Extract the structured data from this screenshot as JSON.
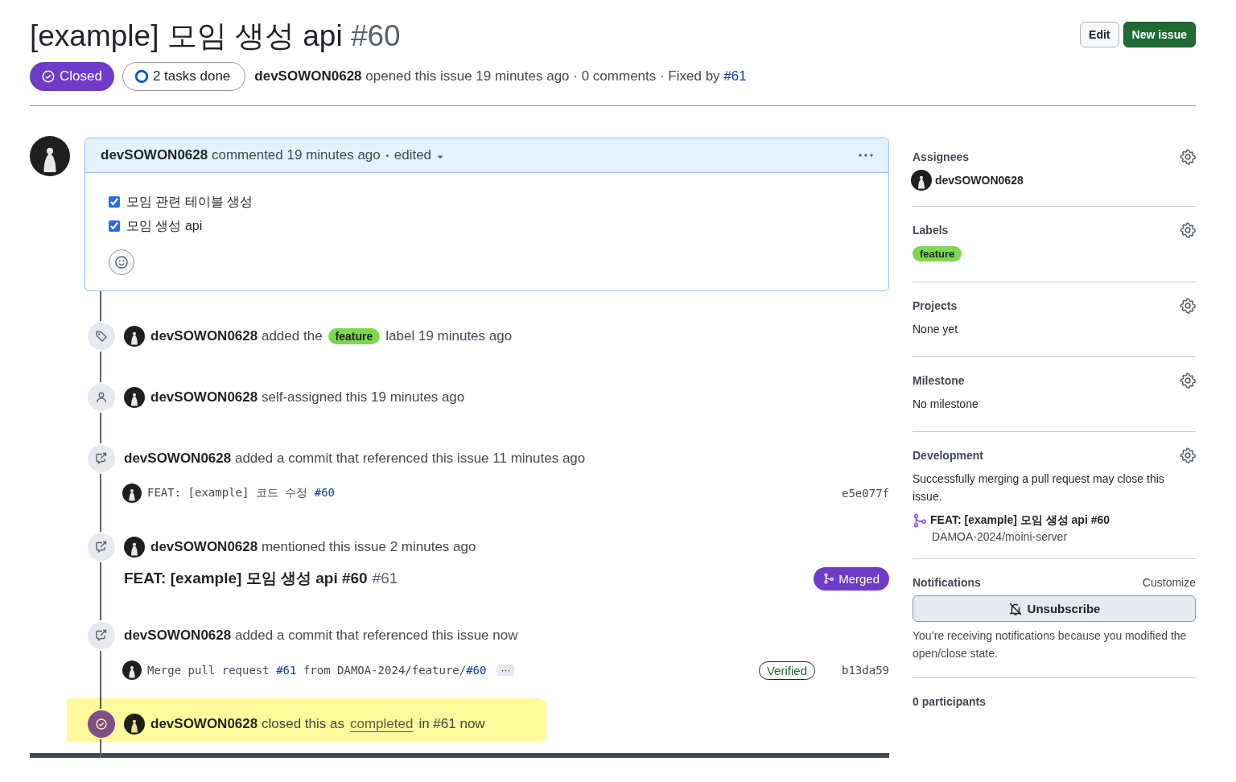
{
  "issue": {
    "title": "[example] 모임 생성 api",
    "number": "#60",
    "state": "Closed",
    "tasks": "2 tasks done",
    "meta": "**devSOWON0628** opened this issue 19 minutes ago · 0 comments · Fixed by",
    "fixed_by": "#61"
  },
  "header_buttons": [
    {
      "label": "Edit",
      "kind": "secondary"
    },
    {
      "label": "New issue",
      "kind": "primary"
    }
  ],
  "comment": {
    "header": "**devSOWON0628** commented 19 minutes ago",
    "edited": "edited",
    "tasks": [
      {
        "label": "모임 관련 테이블 생성",
        "checked": true
      },
      {
        "label": "모임 생성 api",
        "checked": true
      }
    ]
  },
  "timeline": [
    {
      "kind": "label",
      "avatar": true,
      "text": "**devSOWON0628** added the",
      "label": {
        "name": "feature",
        "color": "#7dd84e"
      },
      "after": "label 19 minutes ago"
    },
    {
      "kind": "assign",
      "avatar": true,
      "text": "**devSOWON0628** self-assigned this 19 minutes ago"
    },
    {
      "kind": "reference",
      "avatar": false,
      "text": "**devSOWON0628** added a commit that referenced this issue 11 minutes ago",
      "commit": {
        "parts": [
          {
            "text": "FEAT: [example] 코드 수정 ",
            "kind": "text"
          },
          {
            "text": "#60",
            "kind": "link"
          }
        ],
        "more": false,
        "sha": "e5e077f"
      }
    },
    {
      "kind": "reference",
      "avatar": true,
      "text": "**devSOWON0628** mentioned this issue 2 minutes ago",
      "pr": {
        "title": "FEAT: [example] 모임 생성 api #60",
        "number": "#61",
        "state": "Merged"
      }
    },
    {
      "kind": "reference",
      "avatar": false,
      "text": "**devSOWON0628** added a commit that referenced this issue now",
      "commit": {
        "parts": [
          {
            "text": "Merge pull request ",
            "kind": "text"
          },
          {
            "text": "#61",
            "kind": "link"
          },
          {
            "text": " from DAMOA-2024/feature/",
            "kind": "text"
          },
          {
            "text": "#60",
            "kind": "link"
          }
        ],
        "more": true,
        "more_label": "···",
        "verified": "Verified",
        "sha": "b13da59"
      }
    },
    {
      "kind": "closed",
      "avatar": true,
      "highlighted": true,
      "text": "**devSOWON0628** closed this as",
      "link": "completed",
      "after": "in #61 now"
    }
  ],
  "sidebar": [
    {
      "title": "Assignees",
      "gear": true,
      "items": [
        {
          "kind": "user",
          "name": "devSOWON0628"
        }
      ]
    },
    {
      "title": "Labels",
      "gear": true,
      "items": [
        {
          "kind": "label",
          "name": "feature",
          "color": "#7dd84e"
        }
      ]
    },
    {
      "title": "Projects",
      "gear": true,
      "items": [
        {
          "kind": "text",
          "text": "None yet"
        }
      ]
    },
    {
      "title": "Milestone",
      "gear": true,
      "items": [
        {
          "kind": "text",
          "text": "No milestone"
        }
      ]
    },
    {
      "title": "Development",
      "gear": true,
      "items": [
        {
          "kind": "text",
          "text": "Successfully merging a pull request may close this issue."
        },
        {
          "kind": "pr",
          "title": "FEAT: [example] 모임 생성 api #60",
          "repo": "DAMOA-2024/moini-server"
        }
      ]
    },
    {
      "title": "Notifications",
      "gear": false,
      "action": "Customize",
      "items": [
        {
          "kind": "button",
          "label": "Unsubscribe"
        },
        {
          "kind": "note",
          "text": "You’re receiving notifications because you modified the open/close state."
        }
      ]
    },
    {
      "title": "0 participants",
      "gear": false
    }
  ]
}
